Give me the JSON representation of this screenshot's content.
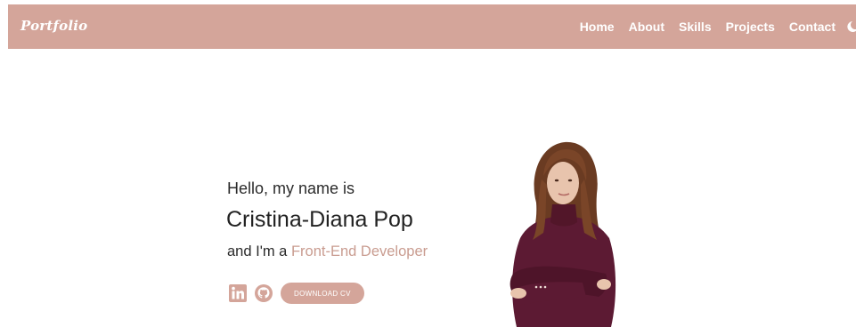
{
  "header": {
    "logo": "Portfolio",
    "nav": [
      {
        "label": "Home"
      },
      {
        "label": "About"
      },
      {
        "label": "Skills"
      },
      {
        "label": "Projects"
      },
      {
        "label": "Contact"
      }
    ],
    "theme_toggle_icon": "moon-icon"
  },
  "hero": {
    "greeting": "Hello, my name is",
    "name": "Cristina-Diana Pop",
    "role_prefix": "and I'm a ",
    "role": "Front-End Developer",
    "download_label": "DOWNLOAD CV",
    "social_icons": [
      "linkedin-icon",
      "github-icon"
    ]
  },
  "colors": {
    "brand": "#d4a59a",
    "accent_text": "#c99c90",
    "header_text": "#ffffff"
  }
}
